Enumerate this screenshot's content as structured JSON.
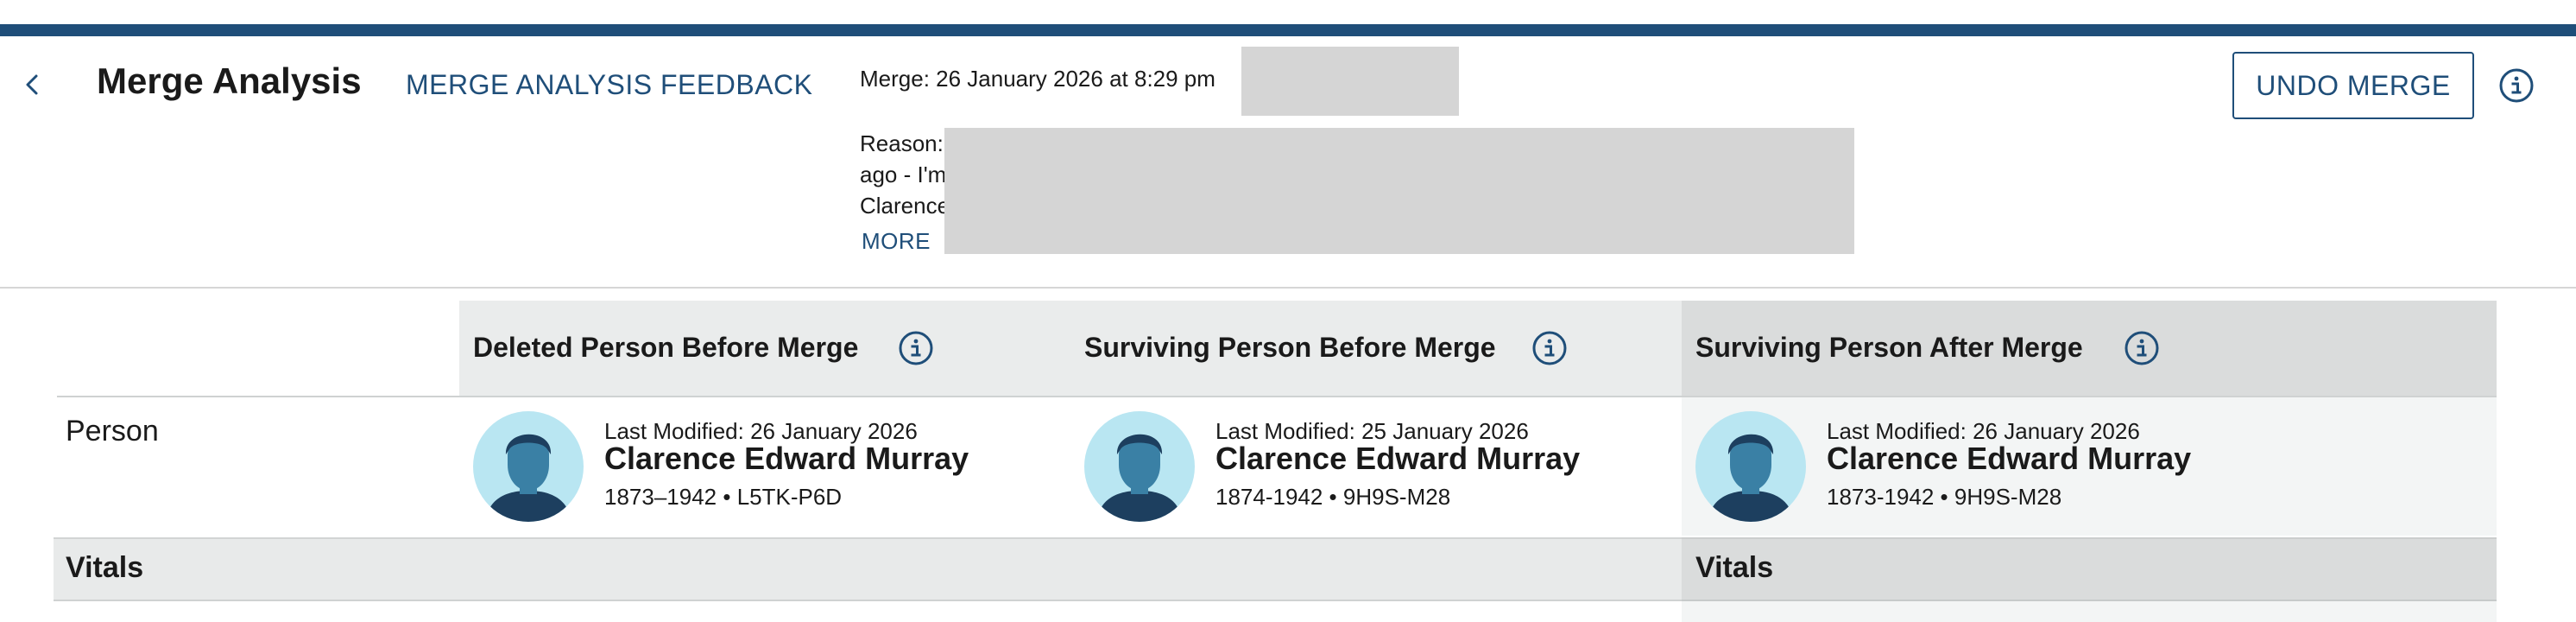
{
  "header": {
    "back_icon": "chevron-left-icon",
    "title": "Merge Analysis",
    "feedback_link": "MERGE ANALYSIS FEEDBACK",
    "merge_label": "Merge: 26 January 2026 at 8:29 pm",
    "reason_lines": [
      "Reason:",
      "ago - I'm",
      "Clarence"
    ],
    "more_link": "MORE",
    "undo_button": "UNDO MERGE",
    "info_icon": "info-icon"
  },
  "columns": [
    {
      "heading": "Deleted Person Before Merge",
      "info_icon": "info-icon"
    },
    {
      "heading": "Surviving Person Before Merge",
      "info_icon": "info-icon"
    },
    {
      "heading": "Surviving Person After Merge",
      "info_icon": "info-icon"
    }
  ],
  "rows": {
    "person_label": "Person",
    "vitals_label": "Vitals",
    "vitals_label_after": "Vitals"
  },
  "persons": [
    {
      "last_modified": "Last Modified: 26 January 2026",
      "name": "Clarence Edward Murray",
      "meta": "1873–1942 • L5TK-P6D",
      "avatar_icon": "male-avatar-icon"
    },
    {
      "last_modified": "Last Modified: 25 January 2026",
      "name": "Clarence Edward Murray",
      "meta": "1874-1942 • 9H9S-M28",
      "avatar_icon": "male-avatar-icon"
    },
    {
      "last_modified": "Last Modified: 26 January 2026",
      "name": "Clarence Edward Murray",
      "meta": "1873-1942 • 9H9S-M28",
      "avatar_icon": "male-avatar-icon"
    }
  ],
  "colors": {
    "accent": "#1f4e79",
    "avatar_bg": "#b9e6f2",
    "avatar_figure": "#3a80a5",
    "avatar_dark": "#1d3f5f"
  }
}
